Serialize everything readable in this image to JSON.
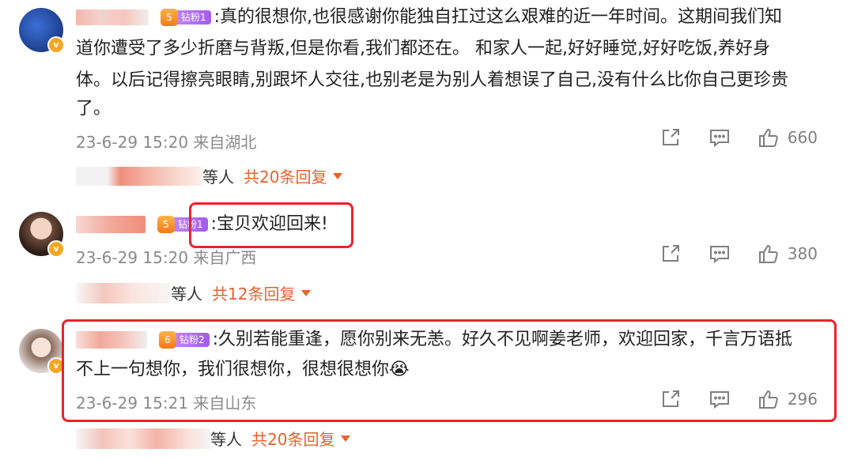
{
  "comments": [
    {
      "fan_label": "钻粉1",
      "fan_level": "5",
      "text_lines": [
        ":真的很想你,也很感谢你能独自扛过这么艰难的近一年时间。这期间我们知",
        "道你遭受了多少折磨与背叛,但是你看,我们都还在。 和家人一起,好好睡觉,好好吃饭,养好身",
        "体。以后记得擦亮眼睛,别跟坏人交往,也别老是为别人着想误了自己,没有什么比你自己更珍贵",
        "了。"
      ],
      "meta": "23-6-29 15:20 来自湖北",
      "likes": "660",
      "reply_suffix": "等人",
      "reply_count": "共20条回复"
    },
    {
      "fan_label": "钻粉1",
      "fan_level": "5",
      "text_lines": [
        ":宝贝欢迎回来!"
      ],
      "meta": "23-6-29 15:20 来自广西",
      "likes": "380",
      "reply_suffix": "等人",
      "reply_count": "共12条回复"
    },
    {
      "fan_label": "钻粉2",
      "fan_level": "6",
      "text_lines": [
        ":久别若能重逢，愿你别来无恙。好久不见啊姜老师，欢迎回家，千言万语抵",
        "不上一句想你，我们很想你，很想很想你😭"
      ],
      "meta": "23-6-29 15:21 来自山东",
      "likes": "296",
      "reply_suffix": "等人",
      "reply_count": "共20条回复"
    }
  ],
  "verified_badge": "v",
  "icons": [
    "share-icon",
    "comment-icon",
    "like-icon"
  ],
  "colors": {
    "accent": "#e8612c",
    "highlight_box": "#e8242b",
    "meta": "#8a8a8a"
  }
}
